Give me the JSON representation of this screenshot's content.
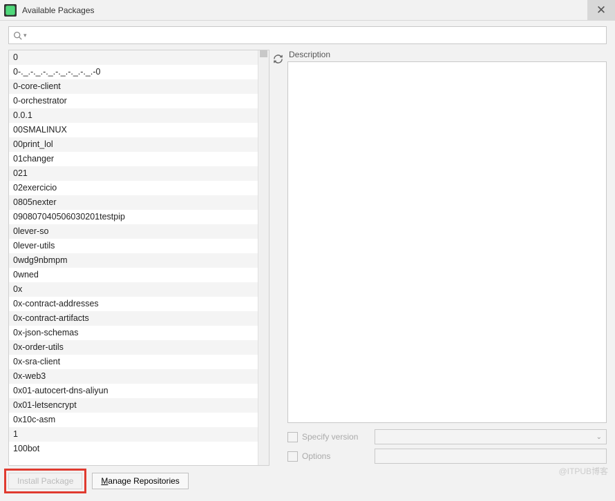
{
  "window": {
    "title": "Available Packages"
  },
  "search": {
    "placeholder": ""
  },
  "packages": [
    "0",
    "0-._.-._.-._.-._.-._.-._.-0",
    "0-core-client",
    "0-orchestrator",
    "0.0.1",
    "00SMALINUX",
    "00print_lol",
    "01changer",
    "021",
    "02exercicio",
    "0805nexter",
    "090807040506030201testpip",
    "0lever-so",
    "0lever-utils",
    "0wdg9nbmpm",
    "0wned",
    "0x",
    "0x-contract-addresses",
    "0x-contract-artifacts",
    "0x-json-schemas",
    "0x-order-utils",
    "0x-sra-client",
    "0x-web3",
    "0x01-autocert-dns-aliyun",
    "0x01-letsencrypt",
    "0x10c-asm",
    "1",
    "100bot"
  ],
  "right": {
    "description_label": "Description",
    "specify_version_label": "Specify version",
    "options_label": "Options"
  },
  "buttons": {
    "install_package": "Install Package",
    "manage_repositories_first": "M",
    "manage_repositories_rest": "anage Repositories"
  },
  "watermark": "@ITPUB博客"
}
